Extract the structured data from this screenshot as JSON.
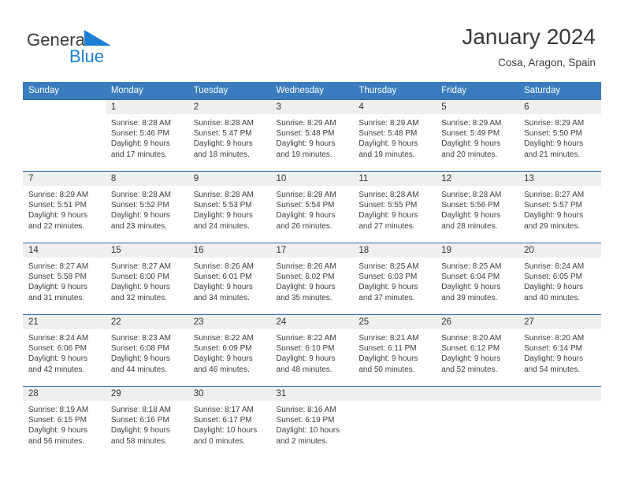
{
  "brand": {
    "name_part1": "General",
    "name_part2": "Blue",
    "triangle_color": "#1b7fd4"
  },
  "header": {
    "title": "January 2024",
    "subtitle": "Cosa, Aragon, Spain"
  },
  "theme": {
    "header_bar_color": "#3a7cbe",
    "day_band_color": "#efefef",
    "grid_line_color": "#2a6aa8",
    "text_color": "#3d3d3d"
  },
  "weekdays": [
    "Sunday",
    "Monday",
    "Tuesday",
    "Wednesday",
    "Thursday",
    "Friday",
    "Saturday"
  ],
  "weeks": [
    [
      {
        "day": "",
        "sunrise": "",
        "sunset": "",
        "daylight_line1": "",
        "daylight_line2": "",
        "blank": true
      },
      {
        "day": "1",
        "sunrise": "Sunrise: 8:28 AM",
        "sunset": "Sunset: 5:46 PM",
        "daylight_line1": "Daylight: 9 hours",
        "daylight_line2": "and 17 minutes."
      },
      {
        "day": "2",
        "sunrise": "Sunrise: 8:28 AM",
        "sunset": "Sunset: 5:47 PM",
        "daylight_line1": "Daylight: 9 hours",
        "daylight_line2": "and 18 minutes."
      },
      {
        "day": "3",
        "sunrise": "Sunrise: 8:29 AM",
        "sunset": "Sunset: 5:48 PM",
        "daylight_line1": "Daylight: 9 hours",
        "daylight_line2": "and 19 minutes."
      },
      {
        "day": "4",
        "sunrise": "Sunrise: 8:29 AM",
        "sunset": "Sunset: 5:48 PM",
        "daylight_line1": "Daylight: 9 hours",
        "daylight_line2": "and 19 minutes."
      },
      {
        "day": "5",
        "sunrise": "Sunrise: 8:29 AM",
        "sunset": "Sunset: 5:49 PM",
        "daylight_line1": "Daylight: 9 hours",
        "daylight_line2": "and 20 minutes."
      },
      {
        "day": "6",
        "sunrise": "Sunrise: 8:29 AM",
        "sunset": "Sunset: 5:50 PM",
        "daylight_line1": "Daylight: 9 hours",
        "daylight_line2": "and 21 minutes."
      }
    ],
    [
      {
        "day": "7",
        "sunrise": "Sunrise: 8:29 AM",
        "sunset": "Sunset: 5:51 PM",
        "daylight_line1": "Daylight: 9 hours",
        "daylight_line2": "and 22 minutes."
      },
      {
        "day": "8",
        "sunrise": "Sunrise: 8:28 AM",
        "sunset": "Sunset: 5:52 PM",
        "daylight_line1": "Daylight: 9 hours",
        "daylight_line2": "and 23 minutes."
      },
      {
        "day": "9",
        "sunrise": "Sunrise: 8:28 AM",
        "sunset": "Sunset: 5:53 PM",
        "daylight_line1": "Daylight: 9 hours",
        "daylight_line2": "and 24 minutes."
      },
      {
        "day": "10",
        "sunrise": "Sunrise: 8:28 AM",
        "sunset": "Sunset: 5:54 PM",
        "daylight_line1": "Daylight: 9 hours",
        "daylight_line2": "and 26 minutes."
      },
      {
        "day": "11",
        "sunrise": "Sunrise: 8:28 AM",
        "sunset": "Sunset: 5:55 PM",
        "daylight_line1": "Daylight: 9 hours",
        "daylight_line2": "and 27 minutes."
      },
      {
        "day": "12",
        "sunrise": "Sunrise: 8:28 AM",
        "sunset": "Sunset: 5:56 PM",
        "daylight_line1": "Daylight: 9 hours",
        "daylight_line2": "and 28 minutes."
      },
      {
        "day": "13",
        "sunrise": "Sunrise: 8:27 AM",
        "sunset": "Sunset: 5:57 PM",
        "daylight_line1": "Daylight: 9 hours",
        "daylight_line2": "and 29 minutes."
      }
    ],
    [
      {
        "day": "14",
        "sunrise": "Sunrise: 8:27 AM",
        "sunset": "Sunset: 5:58 PM",
        "daylight_line1": "Daylight: 9 hours",
        "daylight_line2": "and 31 minutes."
      },
      {
        "day": "15",
        "sunrise": "Sunrise: 8:27 AM",
        "sunset": "Sunset: 6:00 PM",
        "daylight_line1": "Daylight: 9 hours",
        "daylight_line2": "and 32 minutes."
      },
      {
        "day": "16",
        "sunrise": "Sunrise: 8:26 AM",
        "sunset": "Sunset: 6:01 PM",
        "daylight_line1": "Daylight: 9 hours",
        "daylight_line2": "and 34 minutes."
      },
      {
        "day": "17",
        "sunrise": "Sunrise: 8:26 AM",
        "sunset": "Sunset: 6:02 PM",
        "daylight_line1": "Daylight: 9 hours",
        "daylight_line2": "and 35 minutes."
      },
      {
        "day": "18",
        "sunrise": "Sunrise: 8:25 AM",
        "sunset": "Sunset: 6:03 PM",
        "daylight_line1": "Daylight: 9 hours",
        "daylight_line2": "and 37 minutes."
      },
      {
        "day": "19",
        "sunrise": "Sunrise: 8:25 AM",
        "sunset": "Sunset: 6:04 PM",
        "daylight_line1": "Daylight: 9 hours",
        "daylight_line2": "and 39 minutes."
      },
      {
        "day": "20",
        "sunrise": "Sunrise: 8:24 AM",
        "sunset": "Sunset: 6:05 PM",
        "daylight_line1": "Daylight: 9 hours",
        "daylight_line2": "and 40 minutes."
      }
    ],
    [
      {
        "day": "21",
        "sunrise": "Sunrise: 8:24 AM",
        "sunset": "Sunset: 6:06 PM",
        "daylight_line1": "Daylight: 9 hours",
        "daylight_line2": "and 42 minutes."
      },
      {
        "day": "22",
        "sunrise": "Sunrise: 8:23 AM",
        "sunset": "Sunset: 6:08 PM",
        "daylight_line1": "Daylight: 9 hours",
        "daylight_line2": "and 44 minutes."
      },
      {
        "day": "23",
        "sunrise": "Sunrise: 8:22 AM",
        "sunset": "Sunset: 6:09 PM",
        "daylight_line1": "Daylight: 9 hours",
        "daylight_line2": "and 46 minutes."
      },
      {
        "day": "24",
        "sunrise": "Sunrise: 8:22 AM",
        "sunset": "Sunset: 6:10 PM",
        "daylight_line1": "Daylight: 9 hours",
        "daylight_line2": "and 48 minutes."
      },
      {
        "day": "25",
        "sunrise": "Sunrise: 8:21 AM",
        "sunset": "Sunset: 6:11 PM",
        "daylight_line1": "Daylight: 9 hours",
        "daylight_line2": "and 50 minutes."
      },
      {
        "day": "26",
        "sunrise": "Sunrise: 8:20 AM",
        "sunset": "Sunset: 6:12 PM",
        "daylight_line1": "Daylight: 9 hours",
        "daylight_line2": "and 52 minutes."
      },
      {
        "day": "27",
        "sunrise": "Sunrise: 8:20 AM",
        "sunset": "Sunset: 6:14 PM",
        "daylight_line1": "Daylight: 9 hours",
        "daylight_line2": "and 54 minutes."
      }
    ],
    [
      {
        "day": "28",
        "sunrise": "Sunrise: 8:19 AM",
        "sunset": "Sunset: 6:15 PM",
        "daylight_line1": "Daylight: 9 hours",
        "daylight_line2": "and 56 minutes."
      },
      {
        "day": "29",
        "sunrise": "Sunrise: 8:18 AM",
        "sunset": "Sunset: 6:16 PM",
        "daylight_line1": "Daylight: 9 hours",
        "daylight_line2": "and 58 minutes."
      },
      {
        "day": "30",
        "sunrise": "Sunrise: 8:17 AM",
        "sunset": "Sunset: 6:17 PM",
        "daylight_line1": "Daylight: 10 hours",
        "daylight_line2": "and 0 minutes."
      },
      {
        "day": "31",
        "sunrise": "Sunrise: 8:16 AM",
        "sunset": "Sunset: 6:19 PM",
        "daylight_line1": "Daylight: 10 hours",
        "daylight_line2": "and 2 minutes."
      },
      {
        "day": "",
        "sunrise": "",
        "sunset": "",
        "daylight_line1": "",
        "daylight_line2": "",
        "empty": true
      },
      {
        "day": "",
        "sunrise": "",
        "sunset": "",
        "daylight_line1": "",
        "daylight_line2": "",
        "empty": true
      },
      {
        "day": "",
        "sunrise": "",
        "sunset": "",
        "daylight_line1": "",
        "daylight_line2": "",
        "empty": true
      }
    ]
  ]
}
